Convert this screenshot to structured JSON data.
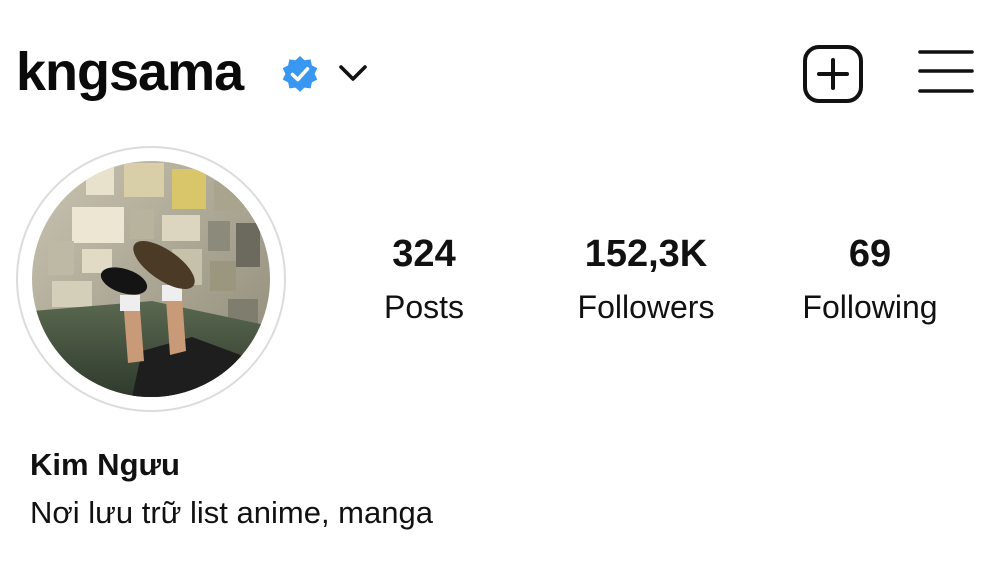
{
  "header": {
    "username": "kngsama",
    "verified_icon": "verified-badge-icon",
    "dropdown_icon": "chevron-down-icon",
    "new_post_icon": "plus-square-icon",
    "menu_icon": "hamburger-menu-icon"
  },
  "profile": {
    "avatar": "profile-photo",
    "stats": [
      {
        "count": "324",
        "label": "Posts"
      },
      {
        "count": "152,3K",
        "label": "Followers"
      },
      {
        "count": "69",
        "label": "Following"
      }
    ],
    "display_name": "Kim Ngưu",
    "bio": "Nơi lưu trữ list anime, manga"
  },
  "colors": {
    "verified_blue": "#3897f0",
    "text": "#111111",
    "background": "#ffffff"
  }
}
